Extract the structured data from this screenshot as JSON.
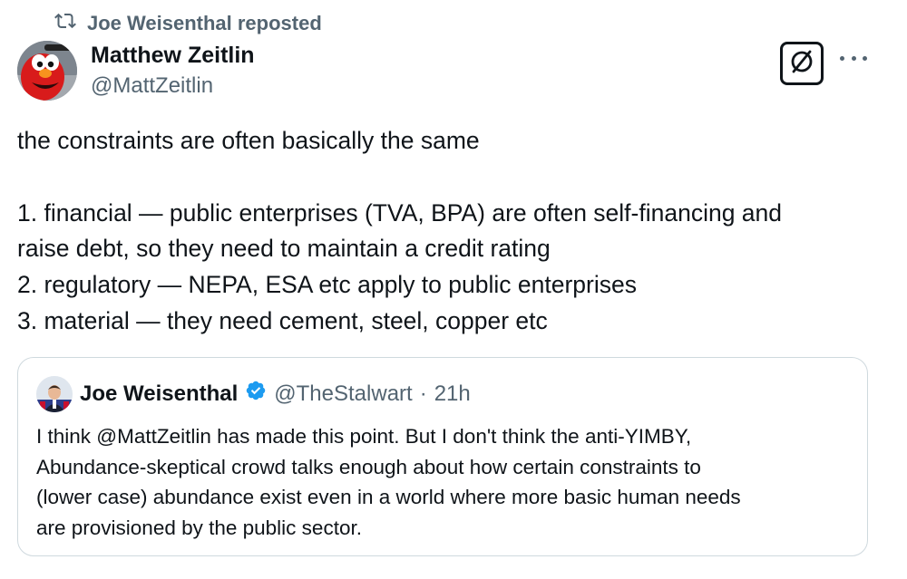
{
  "repost": {
    "label": "Joe Weisenthal reposted",
    "icon": "repost-icon"
  },
  "author": {
    "name": "Matthew Zeitlin",
    "handle": "@MattZeitlin",
    "avatar": "elmo-avatar"
  },
  "actions": {
    "grok_icon": "grok-icon",
    "more_icon": "more-options-icon"
  },
  "tweet": {
    "lines": [
      "the constraints are often basically the same",
      "",
      "1. financial — public enterprises (TVA, BPA) are often self-financing and",
      "raise debt, so they need to maintain a credit rating",
      "2. regulatory — NEPA, ESA etc apply to public enterprises",
      "3. material — they need cement, steel, copper etc"
    ]
  },
  "quote": {
    "name": "Joe Weisenthal",
    "verified": true,
    "handle": "@TheStalwart",
    "separator": "·",
    "time": "21h",
    "lines": [
      "I think @MattZeitlin has made this point. But I don't think the anti-YIMBY,",
      "Abundance-skeptical crowd talks enough about how certain constraints to",
      "(lower case) abundance exist even in a world where more basic human needs",
      "are provisioned by the public sector."
    ]
  },
  "colors": {
    "text": "#0f1419",
    "secondary": "#536471",
    "border": "#cfd9de",
    "verified": "#1d9bf0"
  }
}
